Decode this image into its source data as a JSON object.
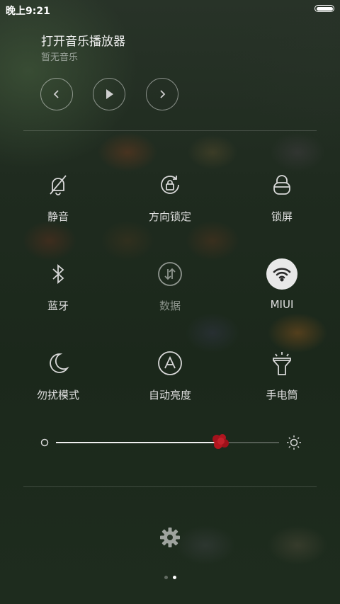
{
  "status_bar": {
    "time": "晚上9:21",
    "battery_icon": "battery-full-icon"
  },
  "music": {
    "title": "打开音乐播放器",
    "subtitle": "暂无音乐",
    "controls": [
      "previous-icon",
      "play-icon",
      "next-icon"
    ]
  },
  "toggles": [
    {
      "label": "静音",
      "icon": "bell-off-icon",
      "active": false,
      "disabled": false
    },
    {
      "label": "方向锁定",
      "icon": "rotation-lock-icon",
      "active": false,
      "disabled": false
    },
    {
      "label": "锁屏",
      "icon": "lock-icon",
      "active": false,
      "disabled": false
    },
    {
      "label": "蓝牙",
      "icon": "bluetooth-icon",
      "active": false,
      "disabled": false
    },
    {
      "label": "数据",
      "icon": "data-icon",
      "active": false,
      "disabled": true
    },
    {
      "label": "MIUI",
      "icon": "wifi-icon",
      "active": true,
      "disabled": false
    },
    {
      "label": "勿扰模式",
      "icon": "moon-icon",
      "active": false,
      "disabled": false
    },
    {
      "label": "自动亮度",
      "icon": "auto-brightness-icon",
      "active": false,
      "disabled": false
    },
    {
      "label": "手电筒",
      "icon": "flashlight-icon",
      "active": false,
      "disabled": false
    }
  ],
  "brightness": {
    "level": 0.73,
    "min_icon": "brightness-low-icon",
    "max_icon": "sun-icon"
  },
  "settings_icon": "gear-icon",
  "page_indicator": {
    "count": 2,
    "current": 2
  },
  "colors": {
    "active_toggle_bg": "#e8e8e8",
    "slider_thumb": "#b0151f"
  }
}
